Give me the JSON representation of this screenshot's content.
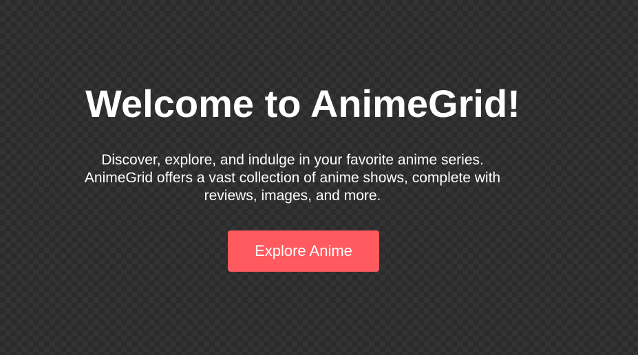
{
  "hero": {
    "title": "Welcome to AnimeGrid!",
    "description": "Discover, explore, and indulge in your favorite anime series. AnimeGrid offers a vast collection of anime shows, complete with reviews, images, and more.",
    "button_label": "Explore Anime"
  },
  "colors": {
    "background": "#2b2b2b",
    "text": "#ffffff",
    "accent": "#ff5a5f"
  }
}
